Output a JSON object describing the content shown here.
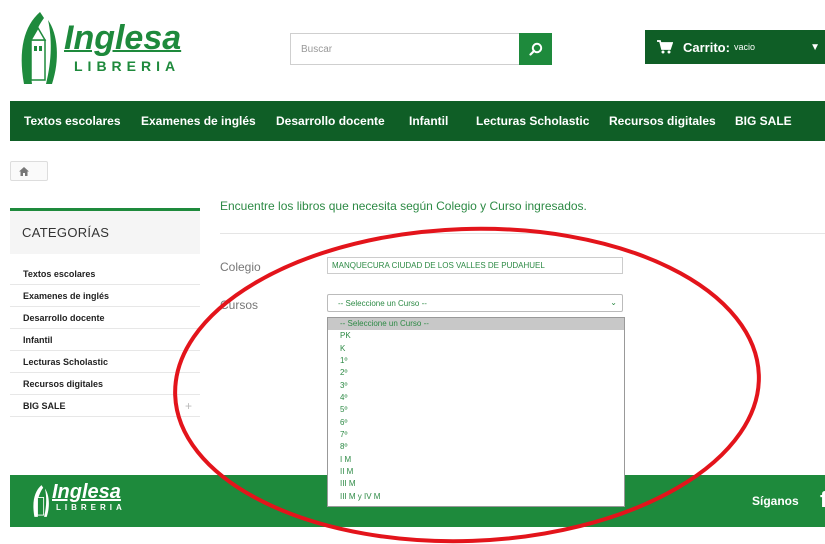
{
  "header": {
    "logo_main": "Inglesa",
    "logo_sub": "LIBRERIA",
    "search_placeholder": "Buscar",
    "cart_label": "Carrito:",
    "cart_state": "vacio"
  },
  "nav": {
    "items": [
      "Textos escolares",
      "Examenes de inglés",
      "Desarrollo docente",
      "Infantil",
      "Lecturas Scholastic",
      "Recursos digitales",
      "BIG SALE"
    ]
  },
  "sidebar": {
    "title": "CATEGORÍAS",
    "items": [
      "Textos escolares",
      "Examenes de inglés",
      "Desarrollo docente",
      "Infantil",
      "Lecturas Scholastic",
      "Recursos digitales",
      "BIG SALE"
    ],
    "expand_glyph": "+"
  },
  "main": {
    "intro": "Encuentre los libros que necesita según Colegio y Curso ingresados.",
    "colegio_label": "Colegio",
    "colegio_value": "MANQUECURA CIUDAD DE LOS VALLES DE PUDAHUEL",
    "cursos_label": "Cursos",
    "cursos_selected": "-- Seleccione un Curso --",
    "cursos_options": [
      "-- Seleccione un Curso --",
      "PK",
      "K",
      "1º",
      "2º",
      "3º",
      "4º",
      "5º",
      "6º",
      "7º",
      "8º",
      "I M",
      "II M",
      "III M",
      "III M y IV M"
    ]
  },
  "footer": {
    "logo_main": "Inglesa",
    "logo_sub": "LIBRERIA",
    "follow_label": "Síganos",
    "facebook_glyph": "f"
  },
  "colors": {
    "brand_green": "#1e8a3c",
    "dark_green": "#0f5e26",
    "annotation_red": "#e3141b"
  }
}
